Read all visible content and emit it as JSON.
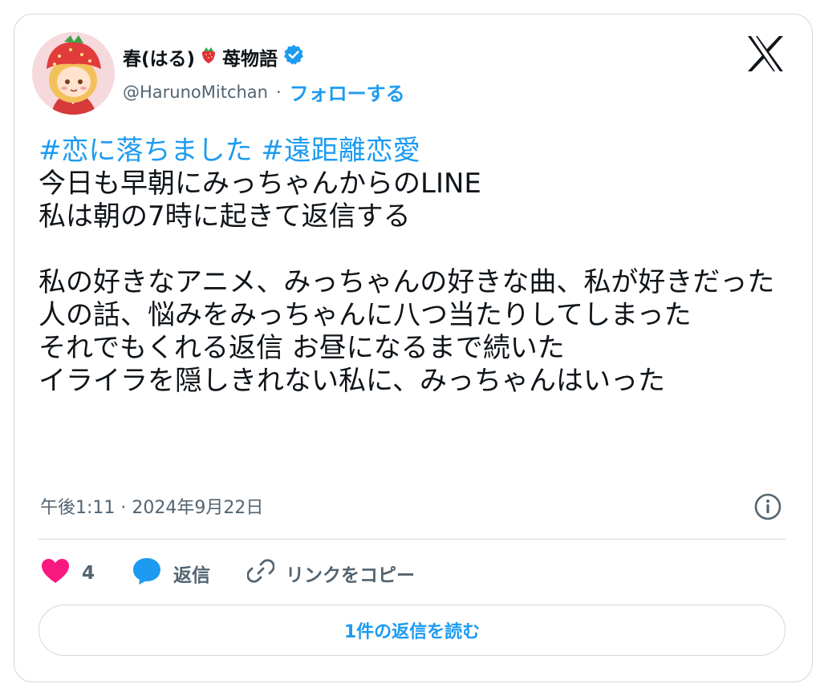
{
  "author": {
    "display_name": "春(はる)",
    "display_name_suffix": "苺物語",
    "handle": "@HarunoMitchan",
    "separator": "·",
    "follow_label": "フォローする",
    "name_emoji": "strawberry-icon",
    "verified_icon": "verified-badge-icon"
  },
  "tweet": {
    "hashtags": "#恋に落ちました #遠距離恋愛",
    "body": "今日も早朝にみっちゃんからのLINE\n私は朝の7時に起きて返信する\n\n私の好きなアニメ、みっちゃんの好きな曲、私が好きだった人の話、悩みをみっちゃんに八つ当たりしてしまった\nそれでもくれる返信 お昼になるまで続いた\nイライラを隠しきれない私に、みっちゃんはいった",
    "timestamp": "午後1:11 · 2024年9月22日"
  },
  "actions": {
    "like_count": "4",
    "reply_label": "返信",
    "copy_link_label": "リンクをコピー"
  },
  "read_replies_label": "1件の返信を読む",
  "colors": {
    "accent": "#1d9bf0",
    "like": "#f91880",
    "muted": "#536471",
    "border": "#cfd9de"
  }
}
